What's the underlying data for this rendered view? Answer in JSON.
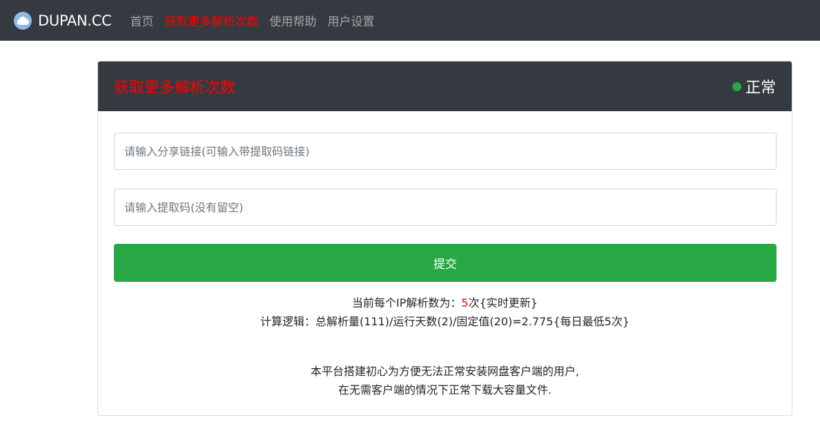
{
  "navbar": {
    "brand": "DUPAN.CC",
    "brand_icon": "cloud-icon",
    "links": [
      {
        "label": "首页",
        "active": false
      },
      {
        "label": "获取更多解析次数",
        "active": true
      },
      {
        "label": "使用帮助",
        "active": false
      },
      {
        "label": "用户设置",
        "active": false
      }
    ]
  },
  "card": {
    "title": "获取更多解析次数",
    "status": "正常",
    "status_color": "#28a745"
  },
  "form": {
    "share_link_placeholder": "请输入分享链接(可输入带提取码链接)",
    "share_link_value": "",
    "extract_code_placeholder": "请输入提取码(没有留空)",
    "extract_code_value": "",
    "submit_label": "提交"
  },
  "info": {
    "line1_prefix": "当前每个IP解析数为：",
    "line1_count": "5",
    "line1_suffix": "次{实时更新}",
    "line2": "计算逻辑：总解析量(111)/运行天数(2)/固定值(20)=2.775{每日最低5次}",
    "notice_line1": "本平台搭建初心为方便无法正常安装网盘客户端的用户,",
    "notice_line2": "在无需客户端的情况下正常下载大容量文件."
  },
  "colors": {
    "navbar_bg": "#343a40",
    "accent_red": "#ff0000",
    "button_green": "#28a745"
  }
}
